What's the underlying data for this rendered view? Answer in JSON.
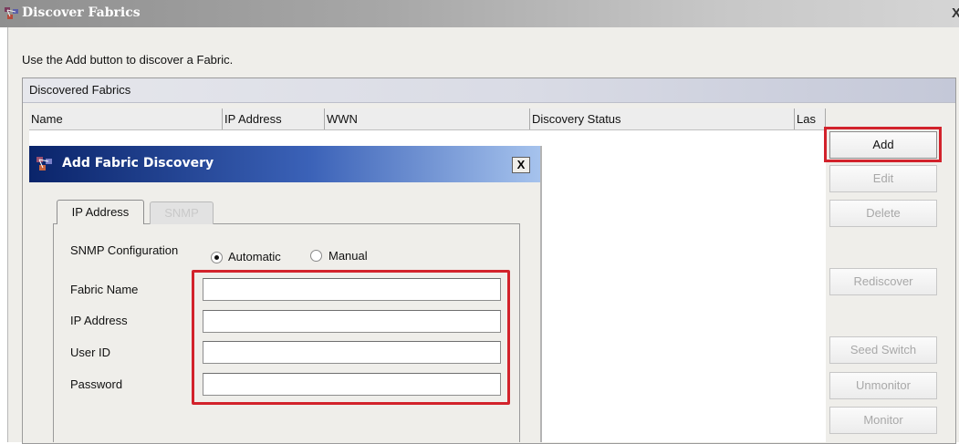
{
  "window": {
    "title": "Discover Fabrics",
    "close_glyph": "X",
    "instruction": "Use the Add button to discover a Fabric."
  },
  "panel": {
    "title": "Discovered Fabrics",
    "columns": [
      "Name",
      "IP Address",
      "WWN",
      "Discovery Status",
      "Las"
    ]
  },
  "buttons": {
    "add": "Add",
    "edit": "Edit",
    "delete": "Delete",
    "rediscover": "Rediscover",
    "seed_switch": "Seed Switch",
    "unmonitor": "Unmonitor",
    "monitor": "Monitor"
  },
  "dialog": {
    "title": "Add Fabric Discovery",
    "close_glyph": "X",
    "tabs": [
      "IP Address",
      "SNMP"
    ],
    "snmp_config_label": "SNMP Configuration",
    "radio_automatic": "Automatic",
    "radio_manual": "Manual",
    "snmp_selected": "Automatic",
    "fields": {
      "fabric_name": {
        "label": "Fabric Name",
        "value": ""
      },
      "ip_address": {
        "label": "IP Address",
        "value": ""
      },
      "user_id": {
        "label": "User ID",
        "value": ""
      },
      "password": {
        "label": "Password",
        "value": ""
      }
    }
  },
  "colors": {
    "highlight": "#d2222b",
    "dialog_titlebar": "#0a246a"
  },
  "icons": [
    "fabric-app-icon",
    "close-icon"
  ]
}
